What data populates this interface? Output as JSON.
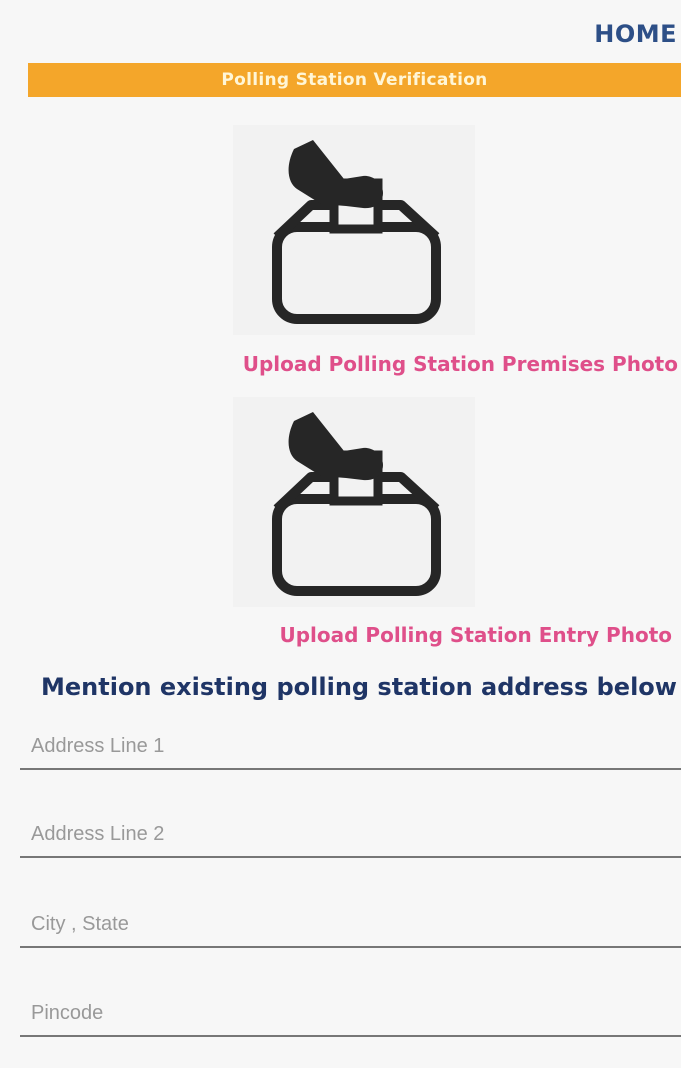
{
  "header": {
    "home_label": "HOME",
    "banner_title": "Polling Station Verification",
    "banner_color": "#f4a62a"
  },
  "uploads": [
    {
      "icon": "ballot-box-icon",
      "label": "Upload Polling Station Premises Photo"
    },
    {
      "icon": "ballot-box-icon",
      "label": "Upload Polling Station Entry Photo"
    }
  ],
  "address": {
    "section_title": "Mention existing polling station address below",
    "fields": [
      {
        "placeholder": "Address Line 1",
        "value": ""
      },
      {
        "placeholder": "Address Line 2",
        "value": ""
      },
      {
        "placeholder": "City , State",
        "value": ""
      },
      {
        "placeholder": "Pincode",
        "value": ""
      }
    ]
  },
  "colors": {
    "accent_pink": "#df4f8a",
    "navy_text": "#1f3566",
    "home_blue": "#2d4f87"
  }
}
